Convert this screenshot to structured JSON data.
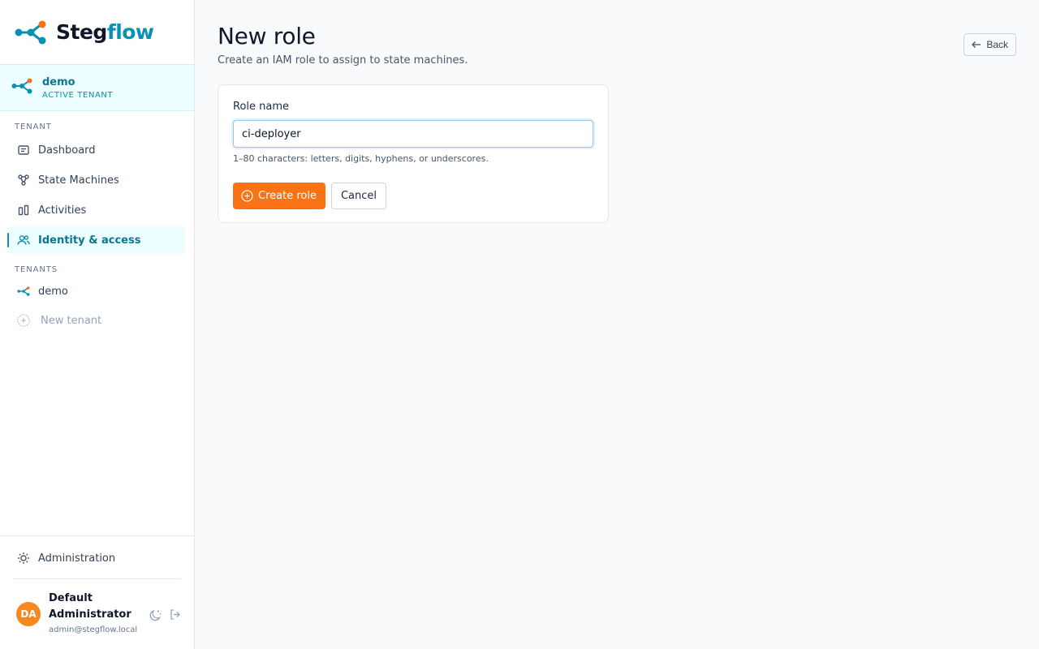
{
  "brand": {
    "name_part1": "Steg",
    "name_part2": "flow"
  },
  "active_tenant": {
    "name": "demo",
    "subtitle": "ACTIVE TENANT"
  },
  "sidebar": {
    "tenant_section_label": "TENANT",
    "tenant_items": [
      {
        "label": "Dashboard",
        "icon": "dashboard-icon"
      },
      {
        "label": "State Machines",
        "icon": "state-machines-icon"
      },
      {
        "label": "Activities",
        "icon": "activities-icon"
      },
      {
        "label": "Identity & access",
        "icon": "users-icon",
        "active": true
      }
    ],
    "tenants_section_label": "TENANTS",
    "tenants": [
      {
        "label": "demo",
        "icon": "tenant-network-icon"
      },
      {
        "label": "New tenant",
        "icon": "plus-circle-icon"
      }
    ],
    "administration_label": "Administration"
  },
  "user": {
    "initials": "DA",
    "name": "Default Administrator",
    "email": "admin@stegflow.local"
  },
  "page": {
    "title": "New role",
    "subtitle": "Create an IAM role to assign to state machines.",
    "back_label": "Back"
  },
  "form": {
    "role_name_label": "Role name",
    "role_name_value": "ci-deployer",
    "role_name_hint": "1–80 characters: letters, digits, hyphens, or underscores.",
    "create_label": "Create role",
    "cancel_label": "Cancel"
  },
  "colors": {
    "accent": "#0891b2",
    "primary_button": "#f97316",
    "avatar": "#f7881f"
  }
}
